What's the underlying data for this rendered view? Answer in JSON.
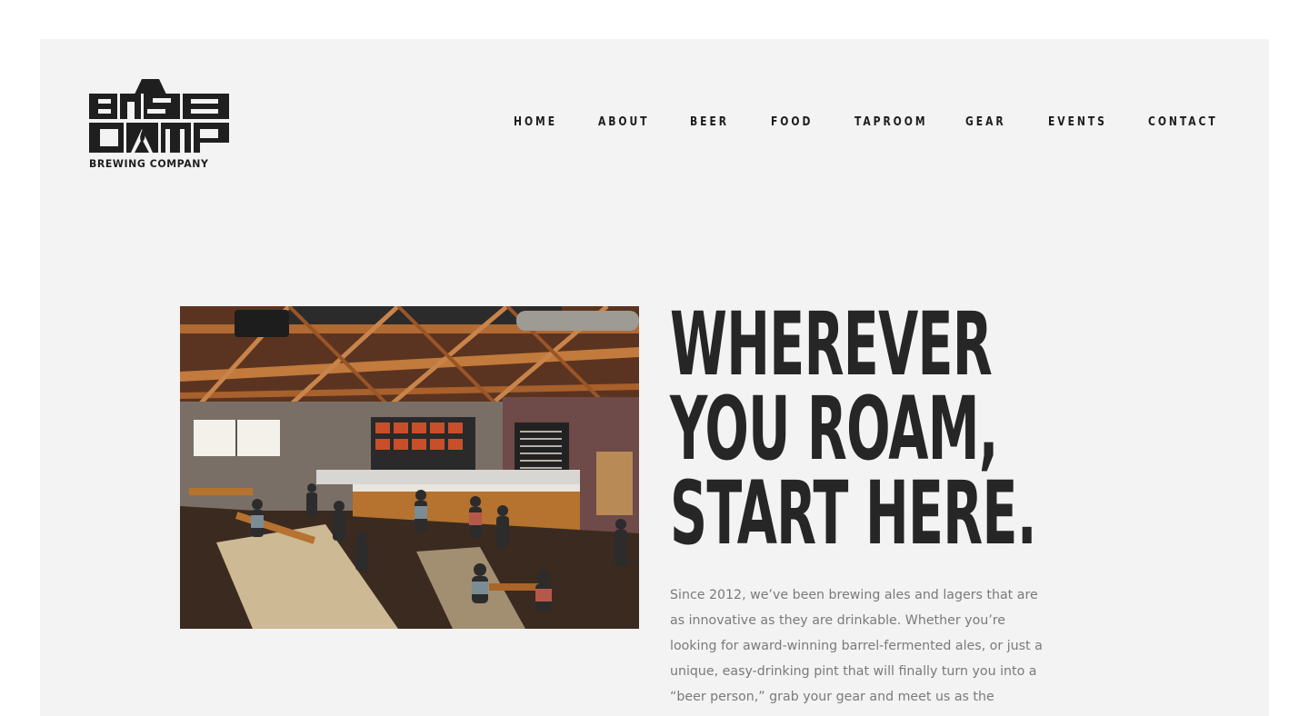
{
  "brand": {
    "logo_text_top": "BASE",
    "logo_text_middle": "CAMP",
    "logo_subtitle": "BREWING COMPANY"
  },
  "nav": {
    "items": [
      {
        "label": "HOME"
      },
      {
        "label": "ABOUT"
      },
      {
        "label": "BEER"
      },
      {
        "label": "FOOD"
      },
      {
        "label": "TAPROOM"
      },
      {
        "label": "GEAR"
      },
      {
        "label": "EVENTS"
      },
      {
        "label": "CONTACT"
      }
    ]
  },
  "hero": {
    "headline_lines": [
      "WHEREVER",
      "YOU ROAM,",
      "START HERE."
    ],
    "body": "Since 2012, we’ve been brewing ales and lagers that are as innovative as they are drinkable. Whether you’re looking for award-winning barrel-fermented ales, or just a unique, easy-drinking pint that will finally turn you into a “beer person,” grab your gear and meet us as the"
  },
  "colors": {
    "page_background": "#ffffff",
    "panel_background": "#f3f3f3",
    "text_dark": "#262626",
    "text_body": "#7a7a7a"
  }
}
